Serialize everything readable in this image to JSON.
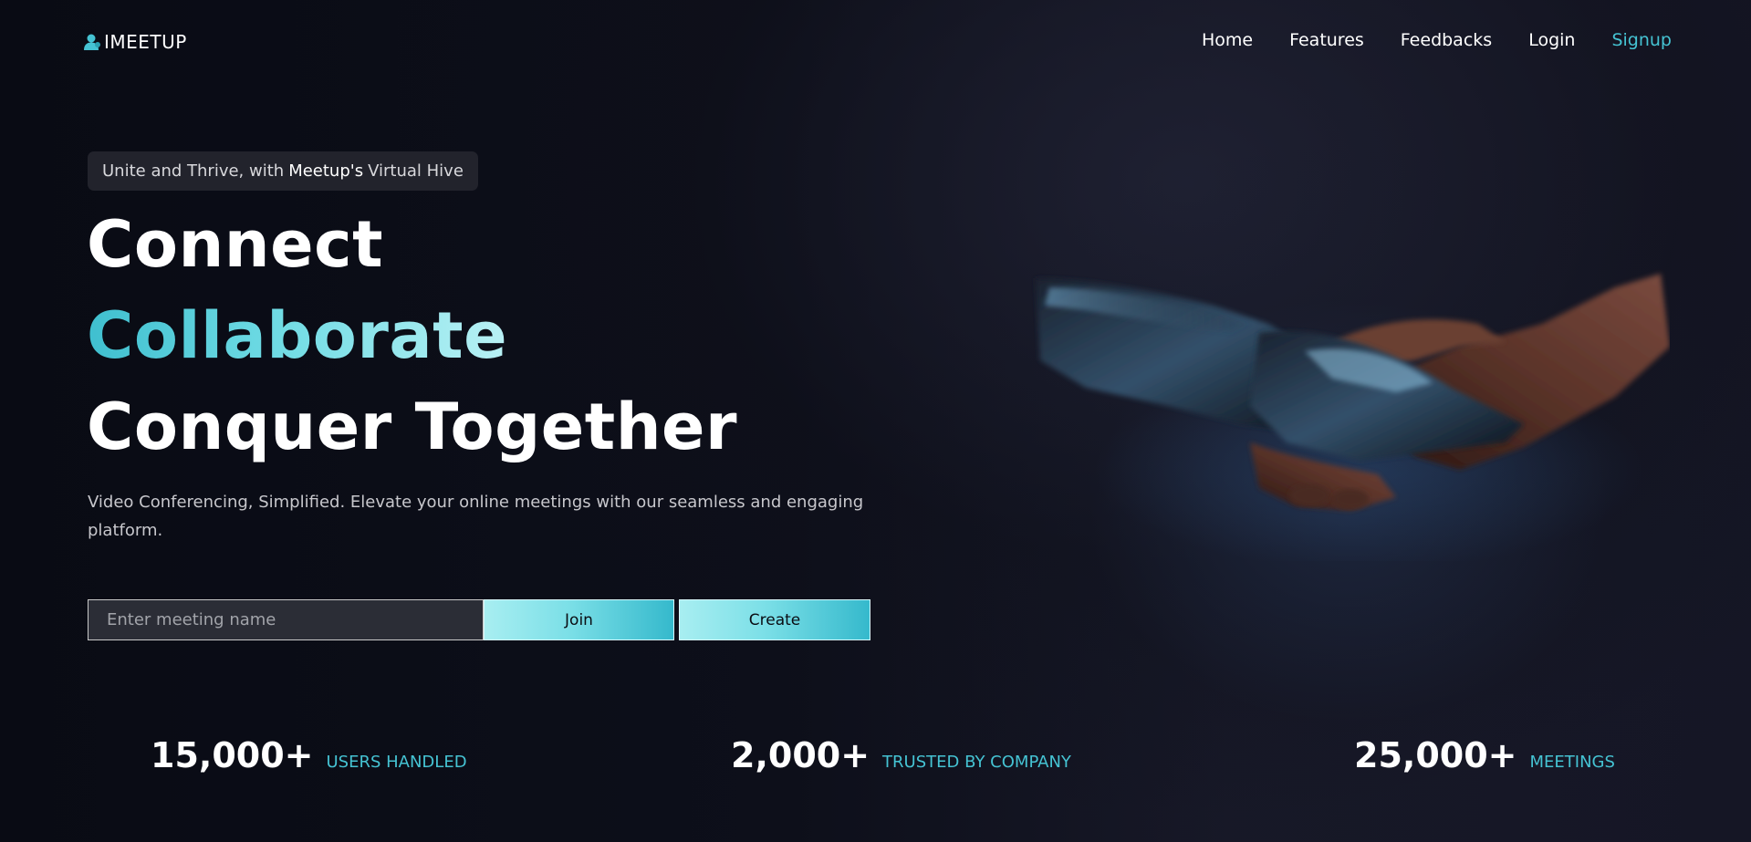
{
  "brand": {
    "name": "IMEETUP",
    "icon": "user-icon",
    "accent_color": "#45c3d3"
  },
  "nav": {
    "items": [
      {
        "label": "Home"
      },
      {
        "label": "Features"
      },
      {
        "label": "Feedbacks"
      },
      {
        "label": "Login"
      },
      {
        "label": "Signup"
      }
    ]
  },
  "hero": {
    "tagline": {
      "prefix": "Unite and Thrive, with",
      "brand": "Meetup's",
      "suffix": "Virtual Hive"
    },
    "headline": {
      "line1": "Connect",
      "line2": "Collaborate",
      "line3": "Conquer Together"
    },
    "description": "Video Conferencing, Simplified. Elevate your online meetings with our seamless and engaging platform.",
    "image": "handshake-illustration"
  },
  "meeting_form": {
    "placeholder": "Enter meeting name",
    "value": "",
    "join_label": "Join",
    "create_label": "Create"
  },
  "stats": [
    {
      "value": "15,000+",
      "label": "USERS HANDLED"
    },
    {
      "value": "2,000+",
      "label": "TRUSTED BY COMPANY"
    },
    {
      "value": "25,000+",
      "label": "MEETINGS"
    }
  ]
}
